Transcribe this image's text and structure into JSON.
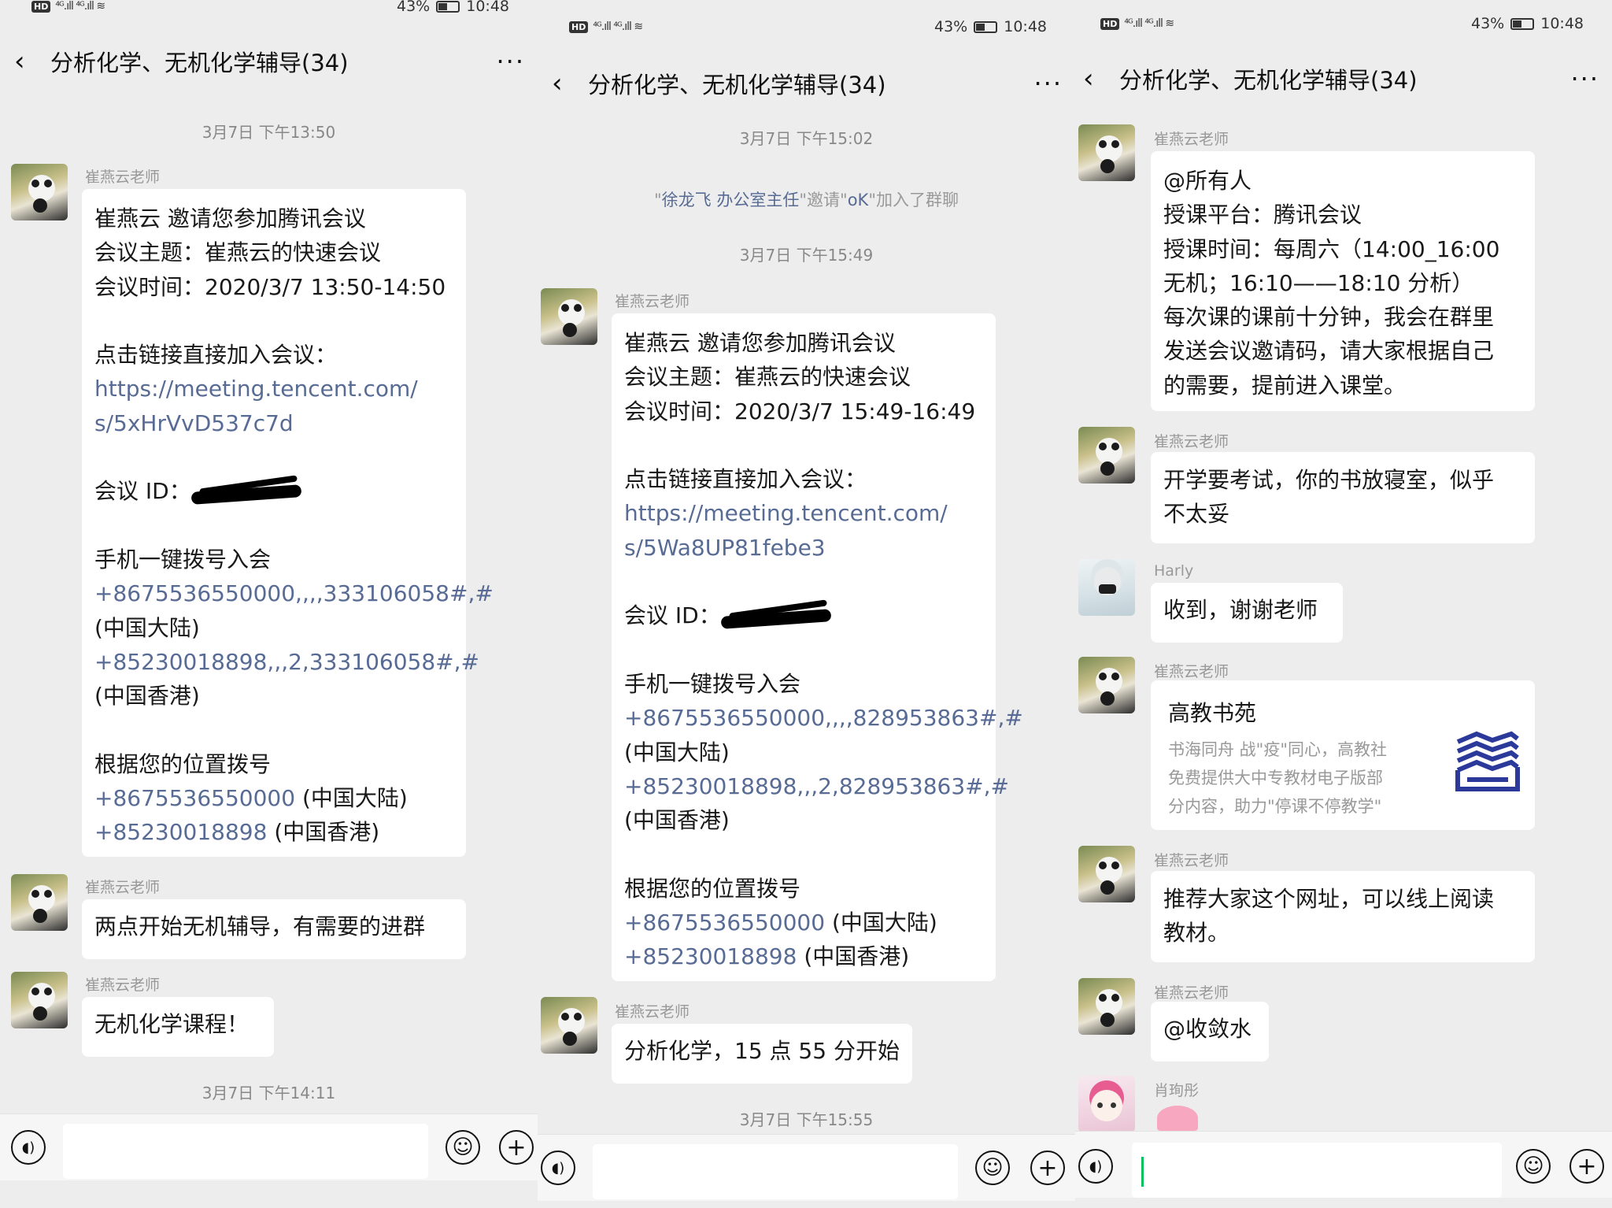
{
  "status": {
    "battery": "43%",
    "time": "10:48",
    "hd": "HD",
    "net": "4G"
  },
  "chat_title": "分析化学、无机化学辅导(34)",
  "teacher": "崔燕云老师",
  "panel1": {
    "ts1": "3月7日 下午13:50",
    "invite": [
      "崔燕云 邀请您参加腾讯会议",
      "会议主题：崔燕云的快速会议",
      "会议时间：2020/3/7 13:50-14:50",
      "",
      "点击链接直接加入会议：",
      "https://meeting.tencent.com/",
      "s/5xHrVvD537c7d",
      "",
      "会议 ID：",
      "",
      "手机一键拨号入会",
      "+8675536550000,,,,333106058#,#",
      "(中国大陆)",
      "+85230018898,,,2,333106058#,#",
      "(中国香港)",
      "",
      "根据您的位置拨号",
      "+8675536550000",
      "(中国大陆)",
      "+85230018898",
      "(中国香港)"
    ],
    "msg2": "两点开始无机辅导，有需要的进群",
    "msg3": "无机化学课程！",
    "ts2": "3月7日 下午14:11"
  },
  "panel2": {
    "ts1": "3月7日 下午15:02",
    "sys_quote1": "\"",
    "sys_name1": "徐龙飞 办公室主任",
    "sys_mid": "\"邀请\"",
    "sys_name2": "oK",
    "sys_end": "\"加入了群聊",
    "ts2": "3月7日 下午15:49",
    "invite": [
      "崔燕云 邀请您参加腾讯会议",
      "会议主题：崔燕云的快速会议",
      "会议时间：2020/3/7 15:49-16:49",
      "",
      "点击链接直接加入会议：",
      "https://meeting.tencent.com/",
      "s/5Wa8UP81febe3",
      "",
      "会议 ID：",
      "",
      "手机一键拨号入会",
      "+8675536550000,,,,828953863#,#",
      "(中国大陆)",
      "+85230018898,,,2,828953863#,#",
      "(中国香港)",
      "",
      "根据您的位置拨号",
      "+8675536550000",
      "(中国大陆)",
      "+85230018898",
      "(中国香港)"
    ],
    "msg2": "分析化学，15 点 55 分开始",
    "ts3": "3月7日 下午15:55"
  },
  "panel3": {
    "msg1": [
      "@所有人",
      "授课平台：腾讯会议",
      "授课时间：每周六（14:00_16:00",
      "无机；16:10——18:10 分析）",
      "每次课的课前十分钟，我会在群里",
      "发送会议邀请码，请大家根据自己",
      "的需要，提前进入课堂。"
    ],
    "msg2": [
      "开学要考试，你的书放寝室，似乎",
      "不太妥"
    ],
    "harly_name": "Harly",
    "harly_msg": "收到，谢谢老师",
    "card_title": "高教书苑",
    "card_desc": [
      "书海同舟 战\"疫\"同心，高教社",
      "免费提供大中专教材电子版部",
      "分内容，助力\"停课不停教学\""
    ],
    "msg4": [
      "推荐大家这个网址，可以线上阅读",
      "教材。"
    ],
    "msg5": "@收敛水",
    "last_name": "肖珣彤"
  },
  "colors": {
    "link": "#576b95",
    "bg": "#ededed",
    "bubble": "#ffffff",
    "cursor": "#07c160"
  }
}
